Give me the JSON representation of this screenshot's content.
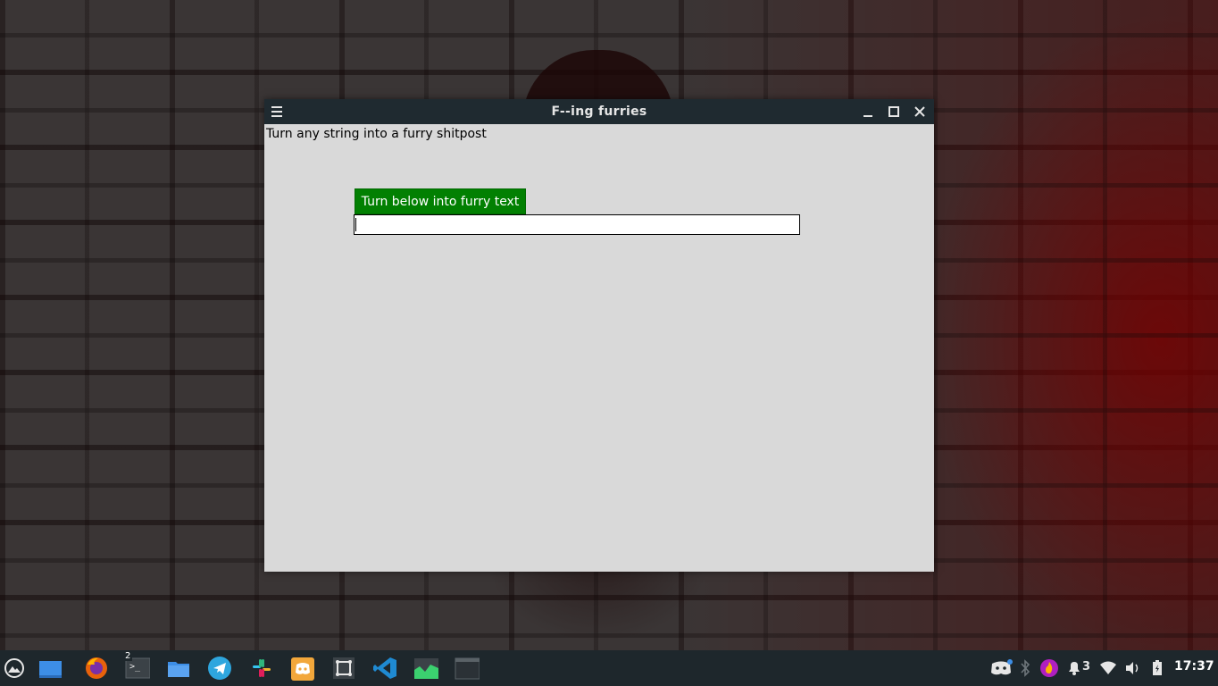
{
  "window": {
    "title": "F--ing furries",
    "subtitle": "Turn any string into a furry shitpost",
    "button_label": "Turn below into furry text",
    "input_value": "",
    "accent_button_color": "#028002"
  },
  "taskbar": {
    "apps": [
      {
        "name": "app-launcher-icon"
      },
      {
        "name": "show-desktop-icon"
      },
      {
        "name": "firefox-icon"
      },
      {
        "name": "terminal-icon",
        "badge": "2"
      },
      {
        "name": "files-icon"
      },
      {
        "name": "telegram-icon"
      },
      {
        "name": "slack-icon"
      },
      {
        "name": "discord-icon"
      },
      {
        "name": "screenshot-tool-icon"
      },
      {
        "name": "vscode-icon"
      },
      {
        "name": "system-monitor-icon"
      },
      {
        "name": "active-window-icon"
      }
    ],
    "tray": {
      "notification_count": "3",
      "clock": "17:37"
    }
  }
}
